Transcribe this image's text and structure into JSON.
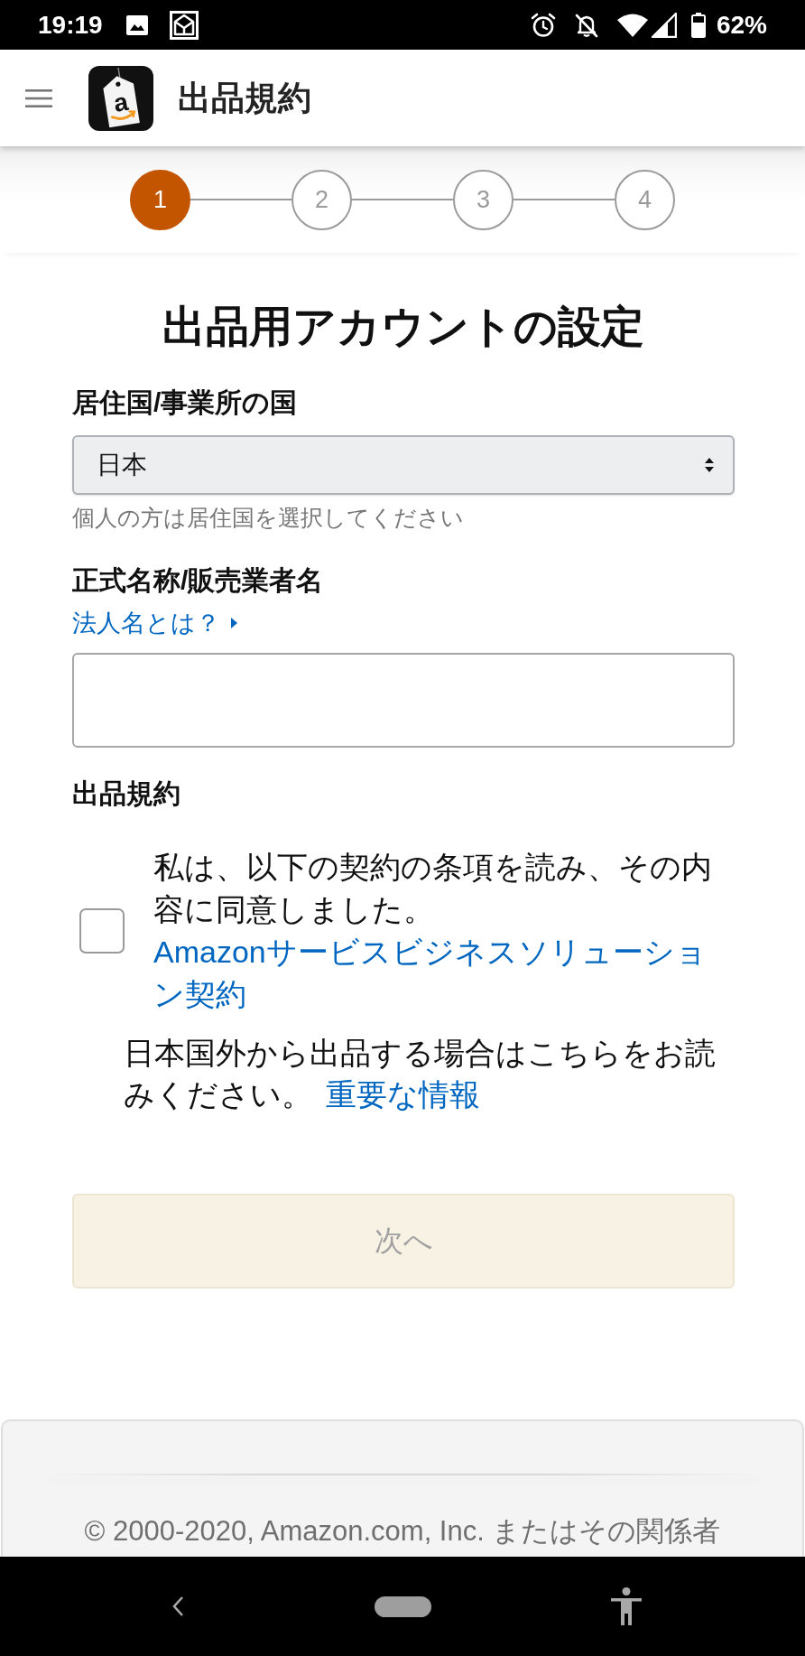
{
  "status_bar": {
    "time": "19:19",
    "battery": "62%"
  },
  "header": {
    "title": "出品規約",
    "logo_letter": "a"
  },
  "stepper": {
    "steps": [
      {
        "label": "1",
        "selected": true
      },
      {
        "label": "2",
        "selected": false
      },
      {
        "label": "3",
        "selected": false
      },
      {
        "label": "4",
        "selected": false
      }
    ]
  },
  "form": {
    "title": "出品用アカウントの設定",
    "fields": [
      {
        "kind": "select",
        "label": "居住国/事業所の国",
        "value": "日本",
        "hint": "個人の方は居住国を選択してください"
      },
      {
        "kind": "text",
        "label": "正式名称/販売業者名",
        "link": "法人名とは？"
      }
    ],
    "agreement": {
      "heading": "出品規約",
      "checked": false,
      "text": "私は、以下の契約の条項を読み、その内容に同意しました。",
      "link": "Amazonサービスビジネスソリューション契約"
    },
    "notice": {
      "text": "日本国外から出品する場合はこちらをお読みください。",
      "link": "重要な情報"
    },
    "next_button": {
      "label": "次へ",
      "disabled": true
    }
  },
  "footer": {
    "copyright": "© 2000-2020, Amazon.com, Inc. またはその関係者"
  }
}
